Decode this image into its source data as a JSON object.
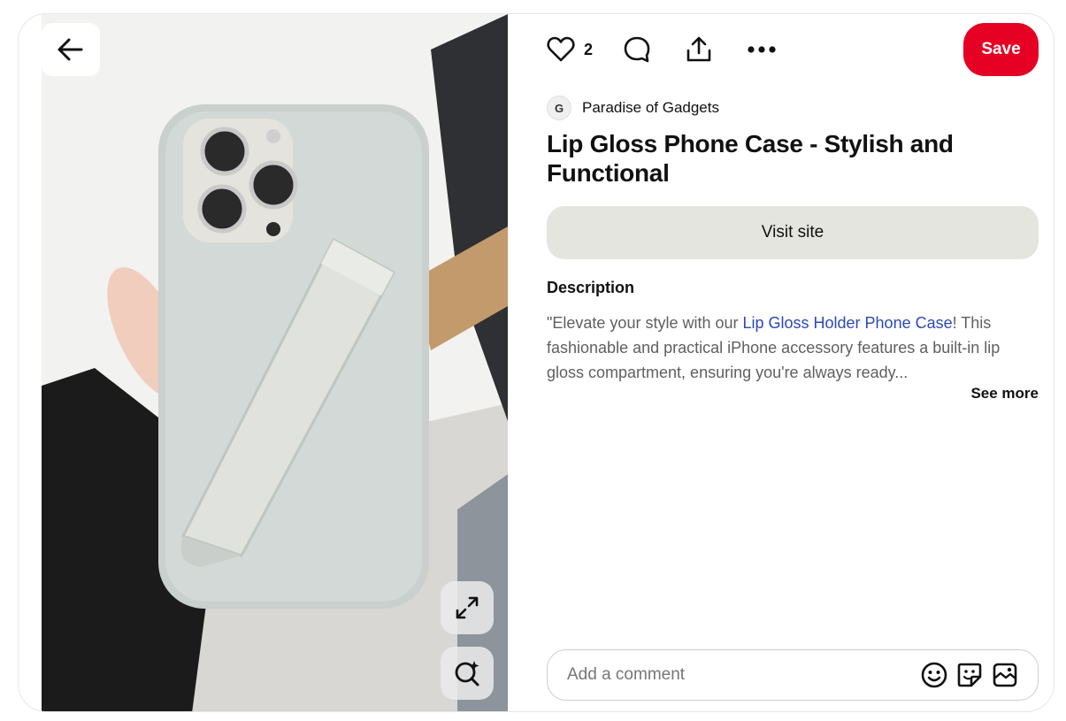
{
  "toolbar": {
    "like_count": "2",
    "save_label": "Save"
  },
  "pin": {
    "author": "Paradise of Gadgets",
    "author_initial": "G",
    "title": "Lip Gloss Phone Case - Stylish and Functional",
    "visit_label": "Visit site",
    "description_heading": "Description",
    "description_prefix": "\"Elevate your style with our ",
    "description_link": "Lip Gloss Holder Phone Case",
    "description_suffix": "! This fashionable and practical iPhone accessory features a built-in lip gloss compartment, ensuring you're always ready...",
    "see_more": "See more"
  },
  "comment": {
    "placeholder": "Add a comment"
  },
  "icons": {
    "back": "arrow-left-icon",
    "like": "heart-icon",
    "comment": "speech-bubble-icon",
    "share": "share-upload-icon",
    "more": "ellipsis-icon",
    "expand": "expand-icon",
    "visual_search": "visual-search-icon",
    "emoji": "emoji-icon",
    "sticker": "sticker-icon",
    "photo": "photo-icon"
  },
  "colors": {
    "save": "#e60023",
    "visit_bg": "#e5e5e0",
    "link": "#2b49b8"
  }
}
